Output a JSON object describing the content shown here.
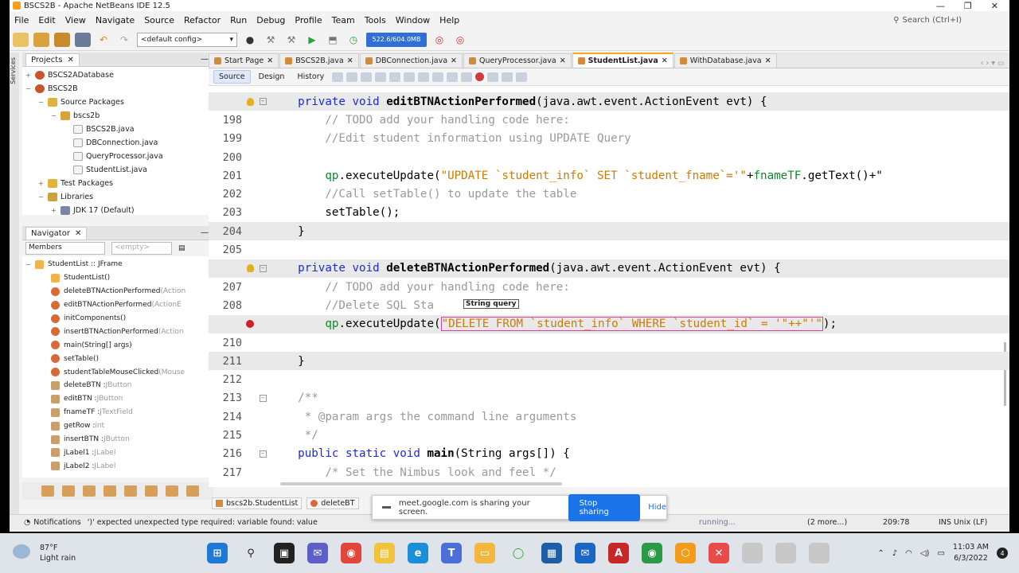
{
  "window": {
    "title": "BSCS2B - Apache NetBeans IDE 12.5",
    "controls": [
      "—",
      "❐",
      "✕"
    ]
  },
  "menu": {
    "items": [
      "File",
      "Edit",
      "View",
      "Navigate",
      "Source",
      "Refactor",
      "Run",
      "Debug",
      "Profile",
      "Team",
      "Tools",
      "Window",
      "Help"
    ],
    "search_placeholder": "Search (Ctrl+I)"
  },
  "toolbar": {
    "config": "<default config>",
    "memory": "522.6/604.0MB"
  },
  "projects": {
    "tab": "Projects",
    "rows": [
      {
        "label": "BSCS2ADatabase",
        "icon": "proj",
        "indent": 0,
        "exp": "+"
      },
      {
        "label": "BSCS2B",
        "icon": "proj",
        "indent": 0,
        "exp": "−"
      },
      {
        "label": "Source Packages",
        "icon": "folder",
        "indent": 1,
        "exp": "−"
      },
      {
        "label": "bscs2b",
        "icon": "pkg",
        "indent": 2,
        "exp": "−"
      },
      {
        "label": "BSCS2B.java",
        "icon": "java",
        "indent": 3,
        "exp": ""
      },
      {
        "label": "DBConnection.java",
        "icon": "java",
        "indent": 3,
        "exp": ""
      },
      {
        "label": "QueryProcessor.java",
        "icon": "java",
        "indent": 3,
        "exp": ""
      },
      {
        "label": "StudentList.java",
        "icon": "java",
        "indent": 3,
        "exp": ""
      },
      {
        "label": "Test Packages",
        "icon": "folder",
        "indent": 1,
        "exp": "+"
      },
      {
        "label": "Libraries",
        "icon": "lib",
        "indent": 1,
        "exp": "−"
      },
      {
        "label": "JDK 17 (Default)",
        "icon": "jdk",
        "indent": 2,
        "exp": "+"
      }
    ]
  },
  "navigator": {
    "tab": "Navigator",
    "filter": "Members",
    "filter2": "<empty>",
    "root": "StudentList :: JFrame",
    "rows": [
      {
        "name": "StudentList()",
        "type": "",
        "icon": "c"
      },
      {
        "name": "deleteBTNActionPerformed",
        "type": "(Action",
        "icon": "m"
      },
      {
        "name": "editBTNActionPerformed",
        "type": "(ActionE",
        "icon": "m"
      },
      {
        "name": "initComponents()",
        "type": "",
        "icon": "m"
      },
      {
        "name": "insertBTNActionPerformed",
        "type": "(Action",
        "icon": "m"
      },
      {
        "name": "main(String[] args)",
        "type": "",
        "icon": "m"
      },
      {
        "name": "setTable()",
        "type": "",
        "icon": "m"
      },
      {
        "name": "studentTableMouseClicked",
        "type": "(Mouse",
        "icon": "m"
      },
      {
        "name": "deleteBTN : ",
        "type": "JButton",
        "icon": "f"
      },
      {
        "name": "editBTN : ",
        "type": "JButton",
        "icon": "f"
      },
      {
        "name": "fnameTF : ",
        "type": "JTextField",
        "icon": "f"
      },
      {
        "name": "getRow : ",
        "type": "int",
        "icon": "f"
      },
      {
        "name": "insertBTN : ",
        "type": "JButton",
        "icon": "f"
      },
      {
        "name": "jLabel1 : ",
        "type": "JLabel",
        "icon": "f"
      },
      {
        "name": "jLabel2 : ",
        "type": "JLabel",
        "icon": "f"
      }
    ]
  },
  "editor": {
    "tabs": [
      {
        "label": "Start Page",
        "active": false
      },
      {
        "label": "BSCS2B.java",
        "active": false
      },
      {
        "label": "DBConnection.java",
        "active": false
      },
      {
        "label": "QueryProcessor.java",
        "active": false
      },
      {
        "label": "StudentList.java",
        "active": true
      },
      {
        "label": "WithDatabase.java",
        "active": false
      }
    ],
    "views": [
      "Source",
      "Design",
      "History"
    ],
    "tooltip": "String query",
    "lines": [
      {
        "n": "",
        "mark": "bulb",
        "fold": "−",
        "hl": true,
        "parts": [
          [
            "    ",
            ""
          ],
          [
            "private void ",
            "kw"
          ],
          [
            "editBTNActionPerformed",
            "fn"
          ],
          [
            "(java.awt.event.ActionEvent evt) {",
            ""
          ]
        ]
      },
      {
        "n": "198",
        "parts": [
          [
            "        // TODO add your handling code here:",
            "cm"
          ]
        ]
      },
      {
        "n": "199",
        "parts": [
          [
            "        //Edit student information using UPDATE Query",
            "cm"
          ]
        ]
      },
      {
        "n": "200",
        "parts": []
      },
      {
        "n": "201",
        "parts": [
          [
            "        ",
            ""
          ],
          [
            "qp",
            "var"
          ],
          [
            ".executeUpdate(",
            ""
          ],
          [
            "\"UPDATE `student_info` SET `student_fname`='\"",
            "str"
          ],
          [
            "+",
            ""
          ],
          [
            "fnameTF",
            "var"
          ],
          [
            ".getText()+\"",
            ""
          ]
        ]
      },
      {
        "n": "202",
        "parts": [
          [
            "        //Call setTable() to update the table",
            "cm"
          ]
        ]
      },
      {
        "n": "203",
        "parts": [
          [
            "        setTable();",
            ""
          ]
        ]
      },
      {
        "n": "204",
        "hl": true,
        "parts": [
          [
            "    }",
            ""
          ]
        ]
      },
      {
        "n": "205",
        "parts": []
      },
      {
        "n": "",
        "mark": "bulb",
        "fold": "−",
        "hl": true,
        "parts": [
          [
            "    ",
            ""
          ],
          [
            "private void ",
            "kw"
          ],
          [
            "deleteBTNActionPerformed",
            "fn"
          ],
          [
            "(java.awt.event.ActionEvent evt) {",
            ""
          ]
        ]
      },
      {
        "n": "207",
        "parts": [
          [
            "        // TODO add your handling code here:",
            "cm"
          ]
        ]
      },
      {
        "n": "208",
        "parts": [
          [
            "        //Delete SQL Sta",
            "cm"
          ]
        ]
      },
      {
        "n": "",
        "mark": "err",
        "hl": true,
        "parts": [
          [
            "        ",
            ""
          ],
          [
            "qp",
            "var"
          ],
          [
            ".executeUpdate(",
            ""
          ],
          [
            "\"DELETE FROM `student_info` WHERE `student_id` = '\"++\"'\"",
            "str box"
          ],
          [
            ");",
            ""
          ]
        ]
      },
      {
        "n": "210",
        "parts": []
      },
      {
        "n": "211",
        "hl": true,
        "parts": [
          [
            "    }",
            ""
          ]
        ]
      },
      {
        "n": "212",
        "parts": []
      },
      {
        "n": "213",
        "fold": "−",
        "parts": [
          [
            "    /**",
            "cm"
          ]
        ]
      },
      {
        "n": "214",
        "parts": [
          [
            "     * @param args the command line arguments",
            "cm"
          ]
        ]
      },
      {
        "n": "215",
        "parts": [
          [
            "     */",
            "cm"
          ]
        ]
      },
      {
        "n": "216",
        "fold": "−",
        "parts": [
          [
            "    ",
            ""
          ],
          [
            "public static void ",
            "kw"
          ],
          [
            "main",
            "fn"
          ],
          [
            "(String args[]) {",
            ""
          ]
        ]
      },
      {
        "n": "217",
        "parts": [
          [
            "        /* Set the Nimbus look and feel */",
            "cm"
          ]
        ]
      }
    ]
  },
  "bottom_tabs": [
    "bscs2b.StudentList",
    "deleteBT"
  ],
  "share_banner": {
    "text": "meet.google.com is sharing your screen.",
    "stop": "Stop sharing",
    "hide": "Hide"
  },
  "status": {
    "notifications": "Notifications",
    "message": "')' expected unexpected type  required: variable  found:    value",
    "running": "running...",
    "more": "(2 more...)",
    "position": "209:78",
    "mode": "INS Unix (LF)"
  },
  "taskbar": {
    "temp": "87°F",
    "weather": "Light rain",
    "time": "11:03 AM",
    "date": "6/3/2022",
    "badge": "4"
  }
}
